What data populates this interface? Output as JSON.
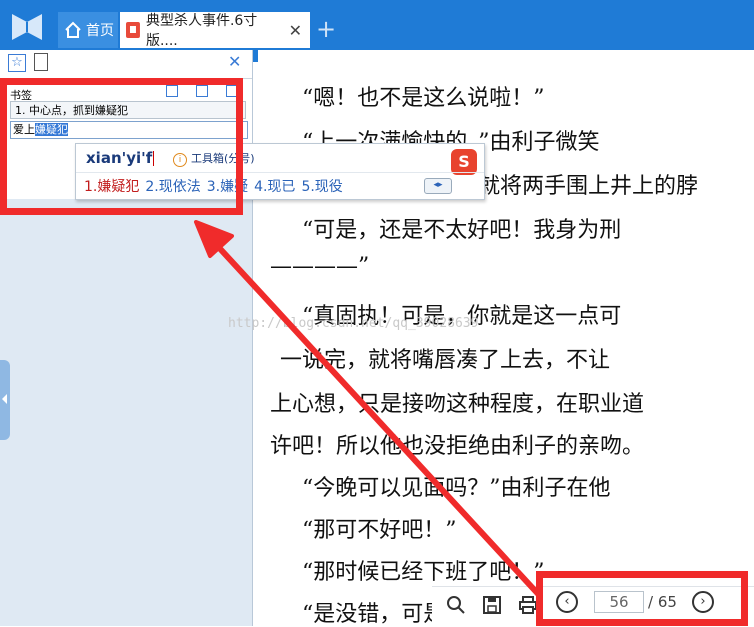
{
  "tabs": {
    "home_label": "首页",
    "doc_label": "典型杀人事件.6寸版....",
    "close": "✕",
    "new_tab": "+"
  },
  "sidebar": {
    "star": "☆",
    "close": "✕",
    "bookmark_title": "书签",
    "bookmark_item": "1. 中心点，抓到嫌疑犯",
    "input_prefix": "爱上",
    "input_selected": "嫌疑犯"
  },
  "ime": {
    "pinyin": "xian'yi'f",
    "tip_icon": "i",
    "tip": "工具箱(分号)",
    "logo": "S",
    "candidates": [
      "1.嫌疑犯",
      "2.现依法",
      "3.嫌疑",
      "4.现已",
      "5.现役"
    ],
    "arrows": "◂▸"
  },
  "reader": {
    "lines": [
      "　　“嗯！也不是这么说啦！”",
      "　　“上一次满愉快的。”由利子微笑",
      "　　　　　　　　　　就将两手围上井上的脖",
      "　　“可是，还是不太好吧！我身为刑",
      "————”",
      "　　“真固执！可是，你就是这一点可",
      "　一说完，就将嘴唇凑了上去，不让",
      "上心想，只是接吻这种程度，在职业道",
      "许吧！所以他也没拒绝由利子的亲吻。",
      "　　“今晚可以见面吗？”由利子在他",
      "　　“那可不好吧！”",
      "　　“那时候已经下班了吧！”",
      "　　“是没错，可是"
    ]
  },
  "watermark": "http://blog.csdn.net/qq_39028639",
  "pager": {
    "prev": "‹",
    "next": "›",
    "current": "56",
    "total": "/ 65"
  },
  "colors": {
    "titlebar": "#1f7bd6",
    "annotation_red": "#f02b2b",
    "candidate_first": "#c21d1d",
    "candidate": "#2b63b8"
  }
}
